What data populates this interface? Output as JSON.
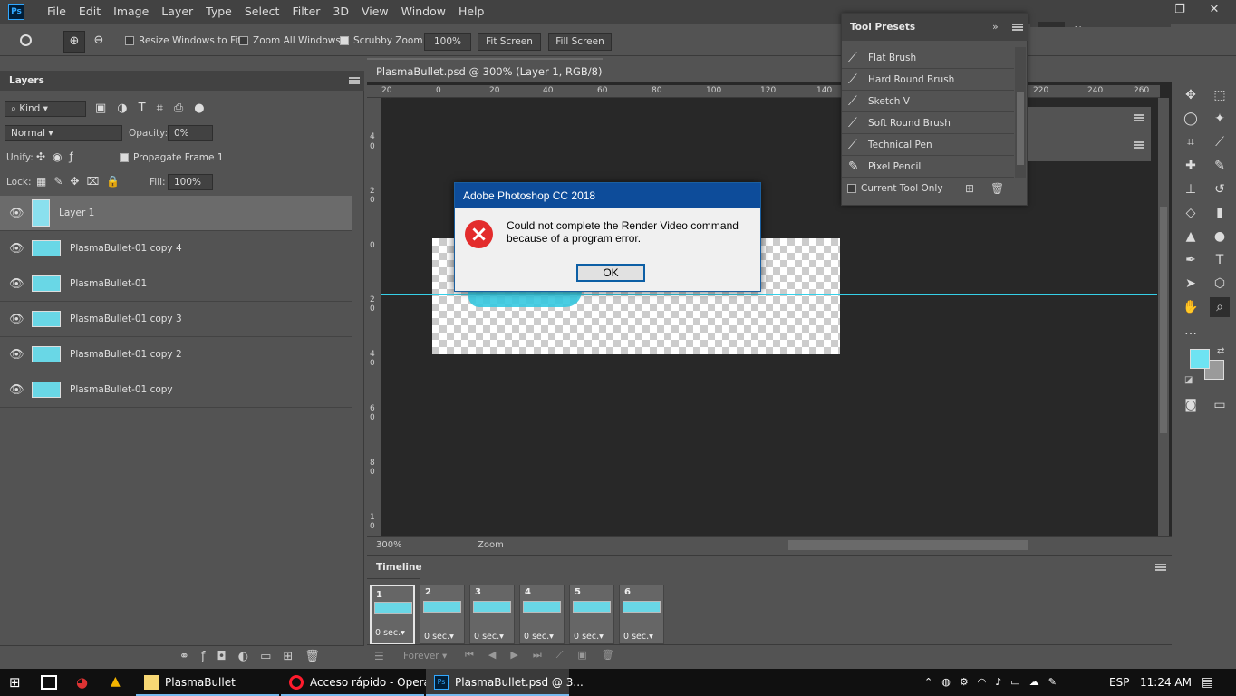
{
  "app": {
    "logo": "Ps"
  },
  "menubar": {
    "items": [
      "File",
      "Edit",
      "Image",
      "Layer",
      "Type",
      "Select",
      "Filter",
      "3D",
      "View",
      "Window",
      "Help"
    ]
  },
  "window_controls": {
    "minimize": "—",
    "restore": "❐",
    "close": "✕"
  },
  "options": {
    "resize_windows": "Resize Windows to Fit",
    "zoom_all": "Zoom All Windows",
    "scrubby_zoom": "Scrubby Zoom",
    "zoom_value": "100%",
    "fit_screen": "Fit Screen",
    "fill_screen": "Fill Screen"
  },
  "layers_panel": {
    "tab": "Layers",
    "filter_kind": "Kind",
    "blend_mode": "Normal",
    "opacity_label": "Opacity:",
    "opacity_value": "0%",
    "unify_label": "Unify:",
    "propagate_label": "Propagate Frame 1",
    "lock_label": "Lock:",
    "fill_label": "Fill:",
    "fill_value": "100%",
    "layers": [
      {
        "name": "Layer 1"
      },
      {
        "name": "PlasmaBullet-01 copy 4"
      },
      {
        "name": "PlasmaBullet-01"
      },
      {
        "name": "PlasmaBullet-01 copy 3"
      },
      {
        "name": "PlasmaBullet-01 copy 2"
      },
      {
        "name": "PlasmaBullet-01 copy"
      }
    ]
  },
  "document": {
    "tab_title": "PlasmaBullet.psd @ 300% (Layer 1, RGB/8)",
    "zoom_status": "300%",
    "status_mode": "Zoom",
    "ruler_top": [
      "20",
      "0",
      "20",
      "40",
      "60",
      "80",
      "100",
      "120",
      "140",
      "220",
      "240",
      "260"
    ],
    "ruler_left": [
      "4",
      "0",
      "2",
      "0",
      "0",
      "2",
      "0",
      "4",
      "0",
      "6",
      "0",
      "8",
      "0",
      "1",
      "0"
    ]
  },
  "dialog": {
    "title": "Adobe Photoshop CC 2018",
    "message_line1": "Could not complete the Render Video command",
    "message_line2": "because of a program error.",
    "ok": "OK"
  },
  "tool_presets": {
    "title": "Tool Presets",
    "items": [
      "Flat Brush",
      "Hard Round Brush",
      "Sketch V",
      "Soft Round Brush",
      "Technical Pen",
      "Pixel Pencil"
    ],
    "current_tool_only": "Current Tool Only"
  },
  "timeline": {
    "tab": "Timeline",
    "loop": "Forever",
    "frames": [
      {
        "num": "1",
        "delay": "0 sec."
      },
      {
        "num": "2",
        "delay": "0 sec."
      },
      {
        "num": "3",
        "delay": "0 sec."
      },
      {
        "num": "4",
        "delay": "0 sec."
      },
      {
        "num": "5",
        "delay": "0 sec."
      },
      {
        "num": "6",
        "delay": "0 sec."
      }
    ]
  },
  "taskbar": {
    "apps": [
      {
        "label": "PlasmaBullet"
      },
      {
        "label": "Acceso rápido - Opera"
      },
      {
        "label": "PlasmaBullet.psd @ 3..."
      }
    ],
    "language": "ESP",
    "time": "11:24 AM"
  },
  "colors": {
    "foreground": "#6ee3f2",
    "background": "#9a9a9a",
    "accent": "#31a8ff"
  }
}
